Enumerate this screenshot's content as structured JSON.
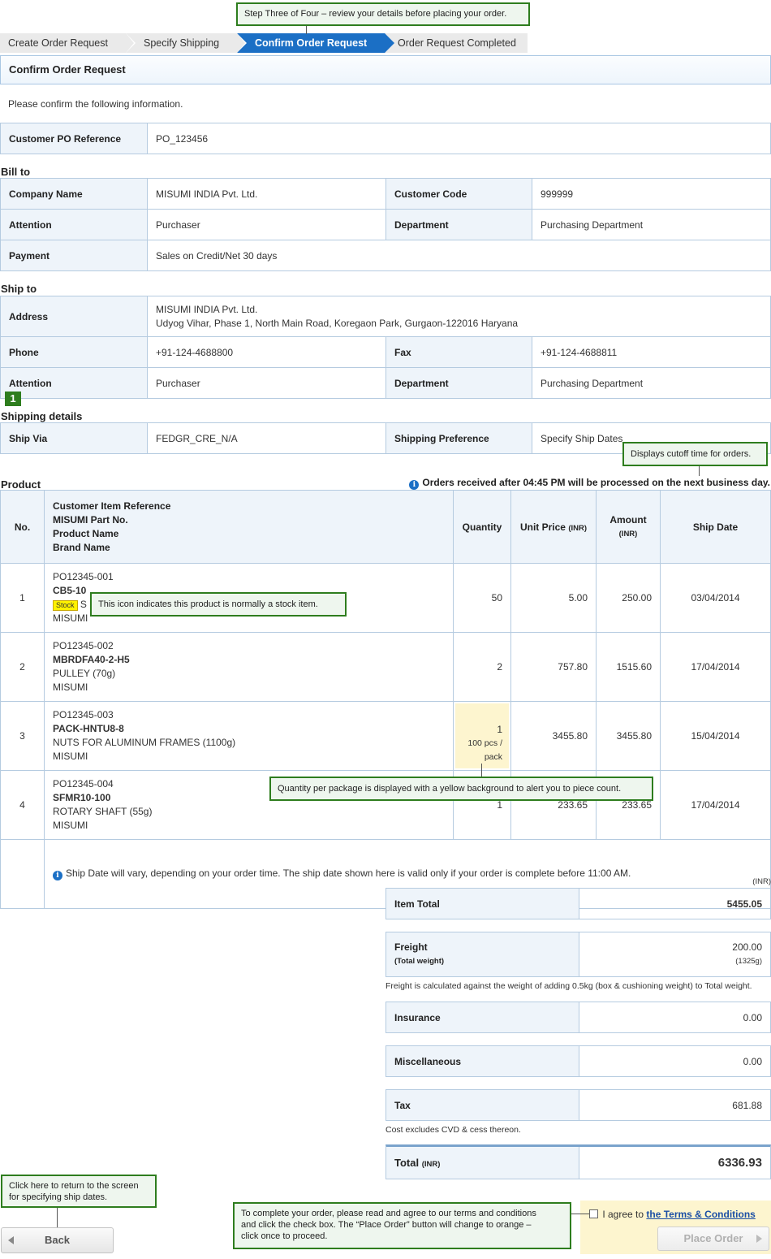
{
  "steps": [
    "Create Order Request",
    "Specify Shipping",
    "Confirm Order Request",
    "Order Request Completed"
  ],
  "page_title": "Confirm Order Request",
  "intro": "Please confirm the following information.",
  "po": {
    "label": "Customer PO Reference",
    "value": "PO_123456"
  },
  "bill_to": {
    "title": "Bill to",
    "company_label": "Company Name",
    "company": "MISUMI INDIA Pvt. Ltd.",
    "code_label": "Customer Code",
    "code": "999999",
    "attention_label": "Attention",
    "attention": "Purchaser",
    "dept_label": "Department",
    "dept": "Purchasing Department",
    "payment_label": "Payment",
    "payment": "Sales on Credit/Net 30 days"
  },
  "ship_to": {
    "title": "Ship to",
    "address_label": "Address",
    "address_line1": "MISUMI INDIA Pvt. Ltd.",
    "address_line2": "Udyog Vihar, Phase 1, North Main Road, Koregaon Park, Gurgaon-122016 Haryana",
    "phone_label": "Phone",
    "phone": "+91-124-4688800",
    "fax_label": "Fax",
    "fax": "+91-124-4688811",
    "attention_label": "Attention",
    "attention": "Purchaser",
    "dept_label": "Department",
    "dept": "Purchasing Department"
  },
  "shipping": {
    "marker": "1",
    "title": "Shipping details",
    "via_label": "Ship Via",
    "via": "FEDGR_CRE_N/A",
    "pref_label": "Shipping Preference",
    "pref": "Specify Ship Dates"
  },
  "product": {
    "title": "Product",
    "cutoff": "Orders received after 04:45 PM will be processed on the next business day.",
    "headers": {
      "no": "No.",
      "item1": "Customer Item Reference",
      "item2": "MISUMI Part No.",
      "item3": "Product Name",
      "item4": "Brand Name",
      "qty": "Quantity",
      "price": "Unit Price",
      "price_unit": "(INR)",
      "amount": "Amount",
      "amount_unit": "(INR)",
      "date": "Ship Date"
    },
    "rows": [
      {
        "no": "1",
        "ref": "PO12345-001",
        "part": "CB5-10",
        "badge": "Stock",
        "name": "S",
        "brand": "MISUMI",
        "qty": "50",
        "price": "5.00",
        "amount": "250.00",
        "date": "03/04/2014"
      },
      {
        "no": "2",
        "ref": "PO12345-002",
        "part": "MBRDFA40-2-H5",
        "name": "PULLEY (70g)",
        "brand": "MISUMI",
        "qty": "2",
        "price": "757.80",
        "amount": "1515.60",
        "date": "17/04/2014"
      },
      {
        "no": "3",
        "ref": "PO12345-003",
        "part": "PACK-HNTU8-8",
        "name": "NUTS FOR ALUMINUM FRAMES (1100g)",
        "brand": "MISUMI",
        "qty": "1",
        "qty_sub1": "100 pcs /",
        "qty_sub2": "pack",
        "price": "3455.80",
        "amount": "3455.80",
        "date": "15/04/2014"
      },
      {
        "no": "4",
        "ref": "PO12345-004",
        "part": "SFMR10-100",
        "name": "ROTARY SHAFT (55g)",
        "brand": "MISUMI",
        "qty": "1",
        "price": "233.65",
        "amount": "233.65",
        "date": "17/04/2014"
      }
    ],
    "note": "Ship Date will vary, depending on your order time. The ship date shown here is valid only if your order is complete before 11:00 AM."
  },
  "totals": {
    "currency": "(INR)",
    "item_total_label": "Item Total",
    "item_total": "5455.05",
    "freight_label": "Freight",
    "freight_sub": "(Total weight)",
    "freight": "200.00",
    "freight_weight": "(1325g)",
    "freight_note": "Freight is calculated against the weight of adding 0.5kg (box & cushioning weight) to Total weight.",
    "insurance_label": "Insurance",
    "insurance": "0.00",
    "misc_label": "Miscellaneous",
    "misc": "0.00",
    "tax_label": "Tax",
    "tax": "681.88",
    "tax_note": "Cost excludes CVD & cess thereon.",
    "total_label": "Total",
    "total_unit": "(INR)",
    "total": "6336.93"
  },
  "callouts": {
    "step": "Step Three of Four – review your details before placing your order.",
    "cutoff": "Displays cutoff time for orders.",
    "stock": "This icon indicates this product is normally a stock item.",
    "qty": "Quantity per package is displayed with a yellow background to alert you to piece count.",
    "back_line1": "Click here to return to the screen",
    "back_line2": "for specifying ship dates.",
    "terms_line1": "To complete your order, please read and agree to our terms and conditions",
    "terms_line2": "and click the check box. The “Place Order” button will change to orange –",
    "terms_line3": "click once to proceed."
  },
  "actions": {
    "back": "Back",
    "agree_prefix": "I agree to",
    "agree_link": "the Terms & Conditions",
    "place_order": "Place Order"
  },
  "colors": {
    "accent": "#1b6fc5",
    "callout_border": "#2e7d1e",
    "qty_highlight": "#fdf5cf",
    "stock_badge": "#fff200"
  }
}
